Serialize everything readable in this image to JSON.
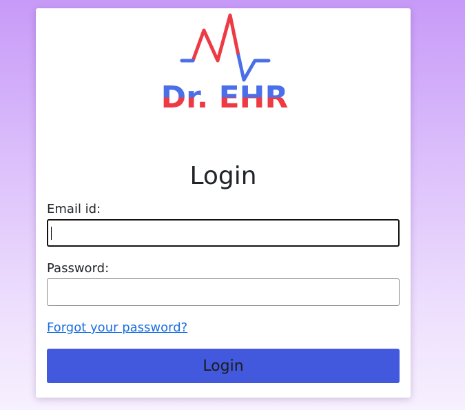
{
  "brand": {
    "logo_text": "Dr. EHR",
    "colors": {
      "red": "#ee3a44",
      "blue": "#4a6fe8"
    }
  },
  "form": {
    "title": "Login",
    "email_label": "Email id:",
    "email_value": "",
    "password_label": "Password:",
    "password_value": "",
    "forgot_link": "Forgot your password?",
    "submit_label": "Login"
  },
  "colors": {
    "accent": "#4259dd",
    "link": "#1a6fe0"
  }
}
